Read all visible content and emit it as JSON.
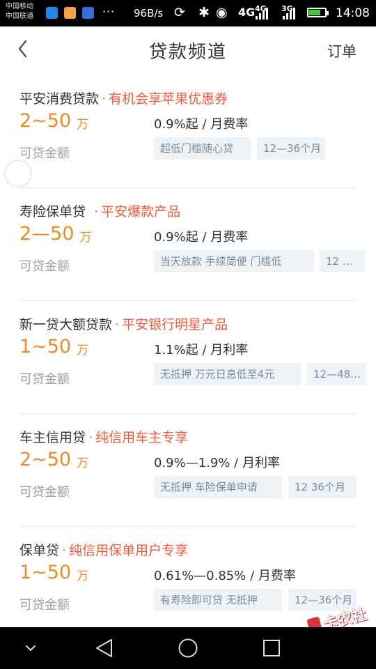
{
  "status_bar": {
    "carrier_line1": "中国移动",
    "carrier_line2": "中国联通",
    "dots": "···",
    "net_speed": "96B/s",
    "net_4g_a": "4G",
    "net_4g_b": "4G",
    "net_3g": "3G",
    "time": "14:08",
    "icons": [
      "shield-app-icon",
      "cat-app-icon",
      "settings-app-icon",
      "sync-icon",
      "bluetooth-icon",
      "eye-icon",
      "signal-icon",
      "battery-charging-icon"
    ]
  },
  "header": {
    "title": "贷款频道",
    "orders_label": "订单",
    "back_icon": "chevron-left-icon"
  },
  "common": {
    "amount_label": "可贷金额",
    "unit": "万"
  },
  "loans": [
    {
      "name": "平安消费贷款",
      "promo": "有机会享苹果优惠券",
      "amount": "2~50",
      "rate": "0.9%起 / 月费率",
      "tags": [
        "超低门槛随心贷",
        "12—36个月"
      ]
    },
    {
      "name": "寿险保单贷",
      "promo": "平安爆款产品",
      "amount": "2—50",
      "rate": "0.9%起 / 月费率",
      "tags": [
        "当天放款 手续简便 门槛低",
        "12 …"
      ]
    },
    {
      "name": "新一贷大额贷款",
      "promo": "平安银行明星产品",
      "amount": "1~50",
      "rate": "1.1%起 / 月利率",
      "tags": [
        "无抵押 万元日息低至4元",
        "12—48…"
      ]
    },
    {
      "name": "车主信用贷",
      "promo": "纯信用车主专享",
      "amount": "2~50",
      "rate": "0.9%—1.9% / 月利率",
      "tags": [
        "无抵押 车险保单申请",
        "12 36个月"
      ]
    },
    {
      "name": "保单贷",
      "promo": "纯信用保单用户专享",
      "amount": "1~50",
      "rate": "0.61%—0.85% / 月费率",
      "tags": [
        "有寿险即可贷 无抵押",
        "12—36个月"
      ]
    }
  ],
  "watermark": {
    "text": "卡农社区"
  },
  "nav_bar": {
    "icons": [
      "collapse-chevron-icon",
      "back-triangle-icon",
      "home-circle-icon",
      "recents-square-icon"
    ]
  },
  "colors": {
    "accent_orange": "#f08a24",
    "promo_red": "#ef5a3c",
    "tag_bg": "#eef3f8",
    "muted_text": "#9aa0a6"
  }
}
